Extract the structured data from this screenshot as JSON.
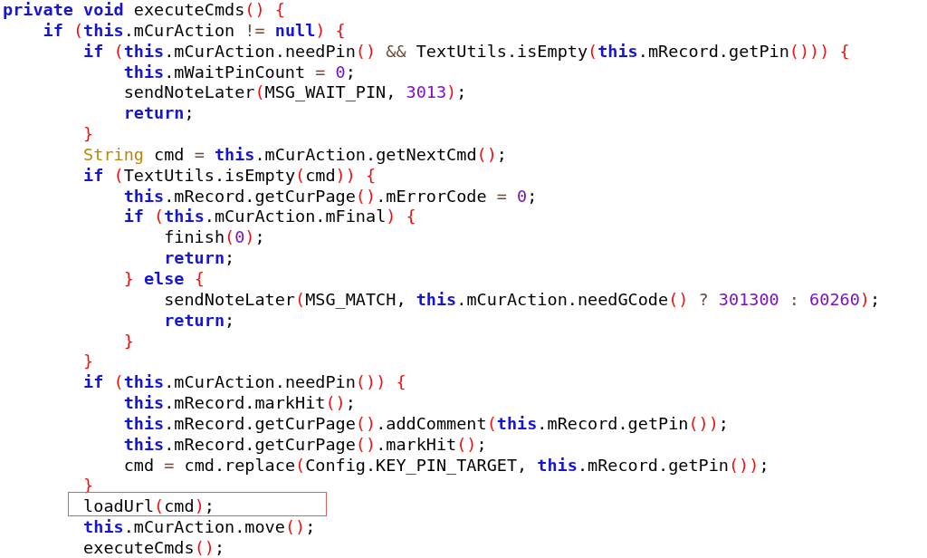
{
  "code_lines": [
    {
      "boxed": false,
      "tokens": [
        {
          "kind": "keyword",
          "text": "private void"
        },
        {
          "kind": "plain",
          "text": " executeCmds"
        },
        {
          "kind": "bracket",
          "text": "()"
        },
        {
          "kind": "bracket",
          "text": " {"
        }
      ]
    },
    {
      "boxed": false,
      "tokens": [
        {
          "kind": "keyword",
          "text": "    if"
        },
        {
          "kind": "bracket",
          "text": " ("
        },
        {
          "kind": "keyword",
          "text": "this"
        },
        {
          "kind": "plain",
          "text": ".mCurAction "
        },
        {
          "kind": "operator",
          "text": "!="
        },
        {
          "kind": "keyword",
          "text": " null"
        },
        {
          "kind": "bracket",
          "text": ")"
        },
        {
          "kind": "bracket",
          "text": " {"
        }
      ]
    },
    {
      "boxed": false,
      "tokens": [
        {
          "kind": "keyword",
          "text": "        if"
        },
        {
          "kind": "bracket",
          "text": " ("
        },
        {
          "kind": "keyword",
          "text": "this"
        },
        {
          "kind": "plain",
          "text": ".mCurAction.needPin"
        },
        {
          "kind": "bracket",
          "text": "()"
        },
        {
          "kind": "operator",
          "text": " &&"
        },
        {
          "kind": "plain",
          "text": " TextUtils.isEmpty"
        },
        {
          "kind": "bracket",
          "text": "("
        },
        {
          "kind": "keyword",
          "text": "this"
        },
        {
          "kind": "plain",
          "text": ".mRecord.getPin"
        },
        {
          "kind": "bracket",
          "text": "()))"
        },
        {
          "kind": "bracket",
          "text": " {"
        }
      ]
    },
    {
      "boxed": false,
      "tokens": [
        {
          "kind": "keyword",
          "text": "            this"
        },
        {
          "kind": "plain",
          "text": ".mWaitPinCount "
        },
        {
          "kind": "operator",
          "text": "="
        },
        {
          "kind": "number",
          "text": " 0"
        },
        {
          "kind": "plain",
          "text": ";"
        }
      ]
    },
    {
      "boxed": false,
      "tokens": [
        {
          "kind": "plain",
          "text": "            sendNoteLater"
        },
        {
          "kind": "bracket",
          "text": "("
        },
        {
          "kind": "plain",
          "text": "MSG_WAIT_PIN, "
        },
        {
          "kind": "number",
          "text": "3013"
        },
        {
          "kind": "bracket",
          "text": ")"
        },
        {
          "kind": "plain",
          "text": ";"
        }
      ]
    },
    {
      "boxed": false,
      "tokens": [
        {
          "kind": "keyword",
          "text": "            return"
        },
        {
          "kind": "plain",
          "text": ";"
        }
      ]
    },
    {
      "boxed": false,
      "tokens": [
        {
          "kind": "bracket",
          "text": "        }"
        }
      ]
    },
    {
      "boxed": false,
      "tokens": [
        {
          "kind": "type",
          "text": "        String"
        },
        {
          "kind": "plain",
          "text": " cmd "
        },
        {
          "kind": "operator",
          "text": "="
        },
        {
          "kind": "keyword",
          "text": " this"
        },
        {
          "kind": "plain",
          "text": ".mCurAction.getNextCmd"
        },
        {
          "kind": "bracket",
          "text": "()"
        },
        {
          "kind": "plain",
          "text": ";"
        }
      ]
    },
    {
      "boxed": false,
      "tokens": [
        {
          "kind": "keyword",
          "text": "        if"
        },
        {
          "kind": "bracket",
          "text": " ("
        },
        {
          "kind": "plain",
          "text": "TextUtils.isEmpty"
        },
        {
          "kind": "bracket",
          "text": "("
        },
        {
          "kind": "plain",
          "text": "cmd"
        },
        {
          "kind": "bracket",
          "text": "))"
        },
        {
          "kind": "bracket",
          "text": " {"
        }
      ]
    },
    {
      "boxed": false,
      "tokens": [
        {
          "kind": "keyword",
          "text": "            this"
        },
        {
          "kind": "plain",
          "text": ".mRecord.getCurPage"
        },
        {
          "kind": "bracket",
          "text": "()"
        },
        {
          "kind": "plain",
          "text": ".mErrorCode "
        },
        {
          "kind": "operator",
          "text": "="
        },
        {
          "kind": "number",
          "text": " 0"
        },
        {
          "kind": "plain",
          "text": ";"
        }
      ]
    },
    {
      "boxed": false,
      "tokens": [
        {
          "kind": "keyword",
          "text": "            if"
        },
        {
          "kind": "bracket",
          "text": " ("
        },
        {
          "kind": "keyword",
          "text": "this"
        },
        {
          "kind": "plain",
          "text": ".mCurAction.mFinal"
        },
        {
          "kind": "bracket",
          "text": ")"
        },
        {
          "kind": "bracket",
          "text": " {"
        }
      ]
    },
    {
      "boxed": false,
      "tokens": [
        {
          "kind": "plain",
          "text": "                finish"
        },
        {
          "kind": "bracket",
          "text": "("
        },
        {
          "kind": "number",
          "text": "0"
        },
        {
          "kind": "bracket",
          "text": ")"
        },
        {
          "kind": "plain",
          "text": ";"
        }
      ]
    },
    {
      "boxed": false,
      "tokens": [
        {
          "kind": "keyword",
          "text": "                return"
        },
        {
          "kind": "plain",
          "text": ";"
        }
      ]
    },
    {
      "boxed": false,
      "tokens": [
        {
          "kind": "bracket",
          "text": "            }"
        },
        {
          "kind": "keyword",
          "text": " else"
        },
        {
          "kind": "bracket",
          "text": " {"
        }
      ]
    },
    {
      "boxed": false,
      "tokens": [
        {
          "kind": "plain",
          "text": "                sendNoteLater"
        },
        {
          "kind": "bracket",
          "text": "("
        },
        {
          "kind": "plain",
          "text": "MSG_MATCH, "
        },
        {
          "kind": "keyword",
          "text": "this"
        },
        {
          "kind": "plain",
          "text": ".mCurAction.needGCode"
        },
        {
          "kind": "bracket",
          "text": "()"
        },
        {
          "kind": "operator",
          "text": " ?"
        },
        {
          "kind": "number",
          "text": " 301300"
        },
        {
          "kind": "operator",
          "text": " :"
        },
        {
          "kind": "number",
          "text": " 60260"
        },
        {
          "kind": "bracket",
          "text": ")"
        },
        {
          "kind": "plain",
          "text": ";"
        }
      ]
    },
    {
      "boxed": false,
      "tokens": [
        {
          "kind": "keyword",
          "text": "                return"
        },
        {
          "kind": "plain",
          "text": ";"
        }
      ]
    },
    {
      "boxed": false,
      "tokens": [
        {
          "kind": "bracket",
          "text": "            }"
        }
      ]
    },
    {
      "boxed": false,
      "tokens": [
        {
          "kind": "bracket",
          "text": "        }"
        }
      ]
    },
    {
      "boxed": false,
      "tokens": [
        {
          "kind": "keyword",
          "text": "        if"
        },
        {
          "kind": "bracket",
          "text": " ("
        },
        {
          "kind": "keyword",
          "text": "this"
        },
        {
          "kind": "plain",
          "text": ".mCurAction.needPin"
        },
        {
          "kind": "bracket",
          "text": "())"
        },
        {
          "kind": "bracket",
          "text": " {"
        }
      ]
    },
    {
      "boxed": false,
      "tokens": [
        {
          "kind": "keyword",
          "text": "            this"
        },
        {
          "kind": "plain",
          "text": ".mRecord.markHit"
        },
        {
          "kind": "bracket",
          "text": "()"
        },
        {
          "kind": "plain",
          "text": ";"
        }
      ]
    },
    {
      "boxed": false,
      "tokens": [
        {
          "kind": "keyword",
          "text": "            this"
        },
        {
          "kind": "plain",
          "text": ".mRecord.getCurPage"
        },
        {
          "kind": "bracket",
          "text": "()"
        },
        {
          "kind": "plain",
          "text": ".addComment"
        },
        {
          "kind": "bracket",
          "text": "("
        },
        {
          "kind": "keyword",
          "text": "this"
        },
        {
          "kind": "plain",
          "text": ".mRecord.getPin"
        },
        {
          "kind": "bracket",
          "text": "())"
        },
        {
          "kind": "plain",
          "text": ";"
        }
      ]
    },
    {
      "boxed": false,
      "tokens": [
        {
          "kind": "keyword",
          "text": "            this"
        },
        {
          "kind": "plain",
          "text": ".mRecord.getCurPage"
        },
        {
          "kind": "bracket",
          "text": "()"
        },
        {
          "kind": "plain",
          "text": ".markHit"
        },
        {
          "kind": "bracket",
          "text": "()"
        },
        {
          "kind": "plain",
          "text": ";"
        }
      ]
    },
    {
      "boxed": false,
      "tokens": [
        {
          "kind": "plain",
          "text": "            cmd "
        },
        {
          "kind": "operator",
          "text": "="
        },
        {
          "kind": "plain",
          "text": " cmd.replace"
        },
        {
          "kind": "bracket",
          "text": "("
        },
        {
          "kind": "plain",
          "text": "Config.KEY_PIN_TARGET, "
        },
        {
          "kind": "keyword",
          "text": "this"
        },
        {
          "kind": "plain",
          "text": ".mRecord.getPin"
        },
        {
          "kind": "bracket",
          "text": "())"
        },
        {
          "kind": "plain",
          "text": ";"
        }
      ]
    },
    {
      "boxed": false,
      "tokens": [
        {
          "kind": "bracket",
          "text": "        }"
        }
      ]
    },
    {
      "boxed": true,
      "tokens": [
        {
          "kind": "plain",
          "text": "        loadUrl"
        },
        {
          "kind": "bracket",
          "text": "("
        },
        {
          "kind": "plain",
          "text": "cmd"
        },
        {
          "kind": "bracket",
          "text": ")"
        },
        {
          "kind": "plain",
          "text": ";"
        }
      ]
    },
    {
      "boxed": false,
      "tokens": [
        {
          "kind": "keyword",
          "text": "        this"
        },
        {
          "kind": "plain",
          "text": ".mCurAction.move"
        },
        {
          "kind": "bracket",
          "text": "()"
        },
        {
          "kind": "plain",
          "text": ";"
        }
      ]
    },
    {
      "boxed": false,
      "tokens": [
        {
          "kind": "plain",
          "text": "        executeCmds"
        },
        {
          "kind": "bracket",
          "text": "()"
        },
        {
          "kind": "plain",
          "text": ";"
        }
      ]
    }
  ]
}
